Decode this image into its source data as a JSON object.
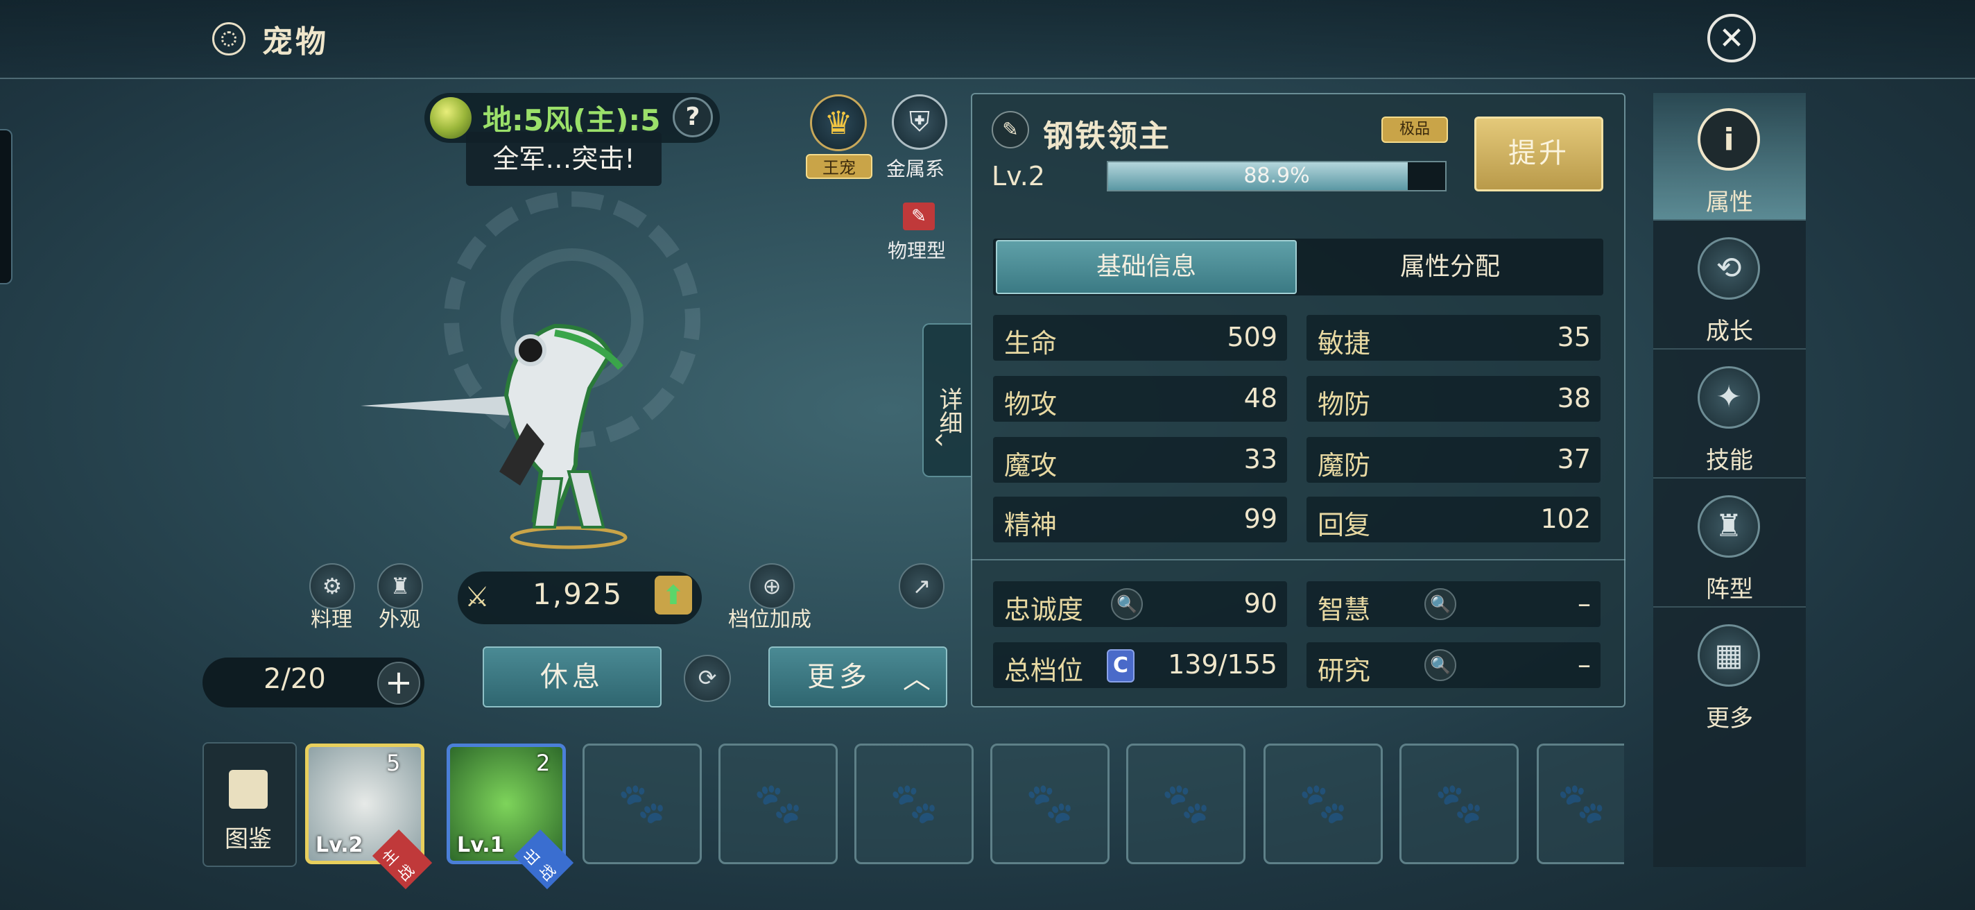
{
  "header": {
    "title": "宠物"
  },
  "elements": {
    "text": "地:5风(主):5",
    "help": "?"
  },
  "quote": "全军…突击!",
  "badges": {
    "king": "王宠",
    "metal": "金属系",
    "type": "物理型"
  },
  "detail_tab": "详细",
  "actions": {
    "cook": "料理",
    "appearance": "外观",
    "slot_bonus": "档位加成"
  },
  "power": "1,925",
  "pet_count": "2/20",
  "buttons": {
    "rest": "休息",
    "more": "更多"
  },
  "codex": "图鉴",
  "slots": [
    {
      "level": "Lv.2",
      "star": "5",
      "tag": "主战"
    },
    {
      "level": "Lv.1",
      "star": "2",
      "tag": "出战"
    }
  ],
  "pet": {
    "name": "钢铁领主",
    "quality": "极品",
    "upgrade": "提升",
    "level": "Lv.2",
    "xp_text": "88.9%",
    "xp_fraction": 0.889
  },
  "tabs": {
    "basic": "基础信息",
    "attr": "属性分配"
  },
  "stats": [
    {
      "label": "生命",
      "value": "509"
    },
    {
      "label": "敏捷",
      "value": "35"
    },
    {
      "label": "物攻",
      "value": "48"
    },
    {
      "label": "物防",
      "value": "38"
    },
    {
      "label": "魔攻",
      "value": "33"
    },
    {
      "label": "魔防",
      "value": "37"
    },
    {
      "label": "精神",
      "value": "99"
    },
    {
      "label": "回复",
      "value": "102"
    }
  ],
  "extra": {
    "loyalty_label": "忠诚度",
    "loyalty_value": "90",
    "wisdom_label": "智慧",
    "wisdom_value": "–",
    "total_label": "总档位",
    "total_grade": "C",
    "total_value": "139/155",
    "research_label": "研究",
    "research_value": "–"
  },
  "sidebar": [
    "属性",
    "成长",
    "技能",
    "阵型",
    "更多"
  ],
  "colors": {
    "accent_gold": "#c9a448",
    "teal": "#3b7a84",
    "label_gold": "#e8d9a2"
  }
}
